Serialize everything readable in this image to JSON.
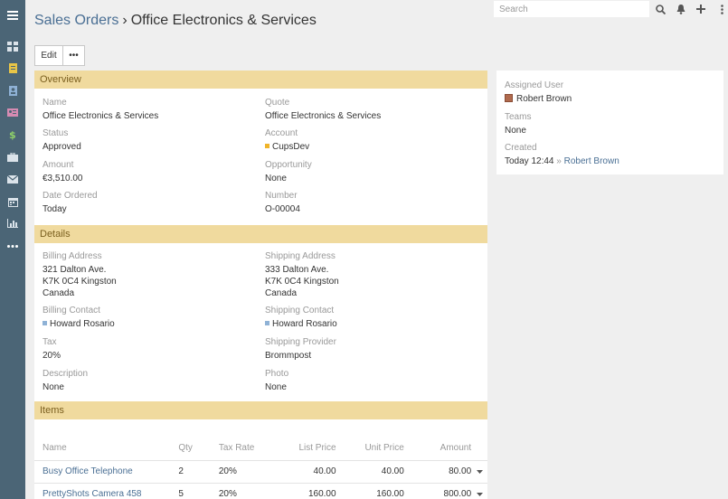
{
  "sidebar": {
    "items": [
      {
        "icon": "menu-icon"
      },
      {
        "icon": "dashboard-icon"
      },
      {
        "icon": "document-icon"
      },
      {
        "icon": "contact-book-icon"
      },
      {
        "icon": "contact-card-icon"
      },
      {
        "icon": "dollar-icon"
      },
      {
        "icon": "briefcase-icon"
      },
      {
        "icon": "envelope-icon"
      },
      {
        "icon": "calendar-icon"
      },
      {
        "icon": "bar-chart-icon"
      },
      {
        "icon": "more-icon"
      }
    ]
  },
  "header": {
    "breadcrumb_parent": "Sales Orders",
    "breadcrumb_separator": "›",
    "title": "Office Electronics & Services",
    "search_placeholder": "Search"
  },
  "actions": {
    "edit_label": "Edit",
    "more_label": "•••"
  },
  "overview": {
    "heading": "Overview",
    "name_label": "Name",
    "name_value": "Office Electronics & Services",
    "quote_label": "Quote",
    "quote_value": "Office Electronics & Services",
    "status_label": "Status",
    "status_value": "Approved",
    "account_label": "Account",
    "account_value": "CupsDev",
    "amount_label": "Amount",
    "amount_value": "€3,510.00",
    "opportunity_label": "Opportunity",
    "opportunity_value": "None",
    "date_label": "Date Ordered",
    "date_value": "Today",
    "number_label": "Number",
    "number_value": "O-00004"
  },
  "details": {
    "heading": "Details",
    "billing_address_label": "Billing Address",
    "billing_address": [
      "321 Dalton Ave.",
      "K7K 0C4 Kingston",
      "Canada"
    ],
    "shipping_address_label": "Shipping Address",
    "shipping_address": [
      "333 Dalton Ave.",
      "K7K 0C4 Kingston",
      "Canada"
    ],
    "billing_contact_label": "Billing Contact",
    "billing_contact_value": "Howard Rosario",
    "shipping_contact_label": "Shipping Contact",
    "shipping_contact_value": "Howard Rosario",
    "tax_label": "Tax",
    "tax_value": "20%",
    "shipping_provider_label": "Shipping Provider",
    "shipping_provider_value": "Brommpost",
    "description_label": "Description",
    "description_value": "None",
    "photo_label": "Photo",
    "photo_value": "None"
  },
  "items": {
    "heading": "Items",
    "columns": {
      "name": "Name",
      "qty": "Qty",
      "tax_rate": "Tax Rate",
      "list_price": "List Price",
      "unit_price": "Unit Price",
      "amount": "Amount"
    },
    "rows": [
      {
        "name": "Busy Office Telephone",
        "qty": "2",
        "tax_rate": "20%",
        "list_price": "40.00",
        "unit_price": "40.00",
        "amount": "80.00"
      },
      {
        "name": "PrettyShots Camera 458",
        "qty": "5",
        "tax_rate": "20%",
        "list_price": "160.00",
        "unit_price": "160.00",
        "amount": "800.00"
      }
    ]
  },
  "side": {
    "assigned_user_label": "Assigned User",
    "assigned_user_value": "Robert Brown",
    "teams_label": "Teams",
    "teams_value": "None",
    "created_label": "Created",
    "created_time": "Today 12:44",
    "created_sep": "»",
    "created_by": "Robert Brown"
  },
  "colors": {
    "sidebar_bg": "#4b6576",
    "panel_heading_bg": "#f0da9e",
    "link": "#4a6f94",
    "account_dot": "#f0b429",
    "contact_dot": "#8fb2d6"
  }
}
